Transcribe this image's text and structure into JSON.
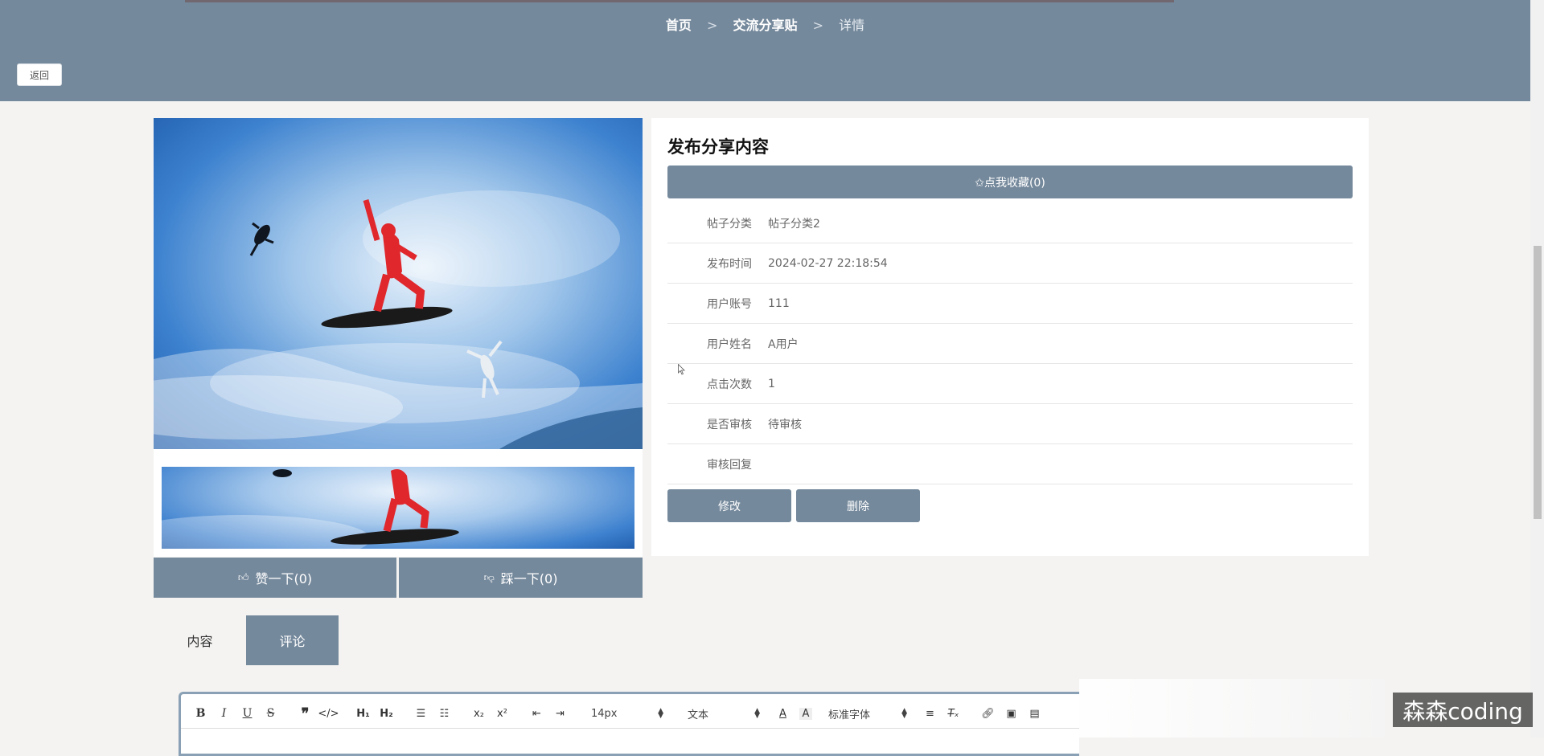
{
  "breadcrumb": {
    "home": "首页",
    "section": "交流分享贴",
    "current": "详情",
    "separator": ">"
  },
  "back_label": "返回",
  "vote": {
    "like_label": "赞一下(0)",
    "dislike_label": "踩一下(0)"
  },
  "detail": {
    "title": "发布分享内容",
    "favorite_label": "✩点我收藏(0)",
    "fields": [
      {
        "label": "帖子分类",
        "value": "帖子分类2"
      },
      {
        "label": "发布时间",
        "value": "2024-02-27 22:18:54"
      },
      {
        "label": "用户账号",
        "value": "111"
      },
      {
        "label": "用户姓名",
        "value": "A用户"
      },
      {
        "label": "点击次数",
        "value": "1"
      },
      {
        "label": "是否审核",
        "value": "待审核"
      },
      {
        "label": "审核回复",
        "value": ""
      }
    ],
    "edit_label": "修改",
    "delete_label": "删除"
  },
  "tabs": {
    "content_label": "内容",
    "comment_label": "评论"
  },
  "editor": {
    "font_size": "14px",
    "block_format": "文本",
    "font_family": "标准字体"
  },
  "watermark": "森森coding",
  "colors": {
    "primary": "#75899c",
    "background": "#f4f3f2"
  }
}
